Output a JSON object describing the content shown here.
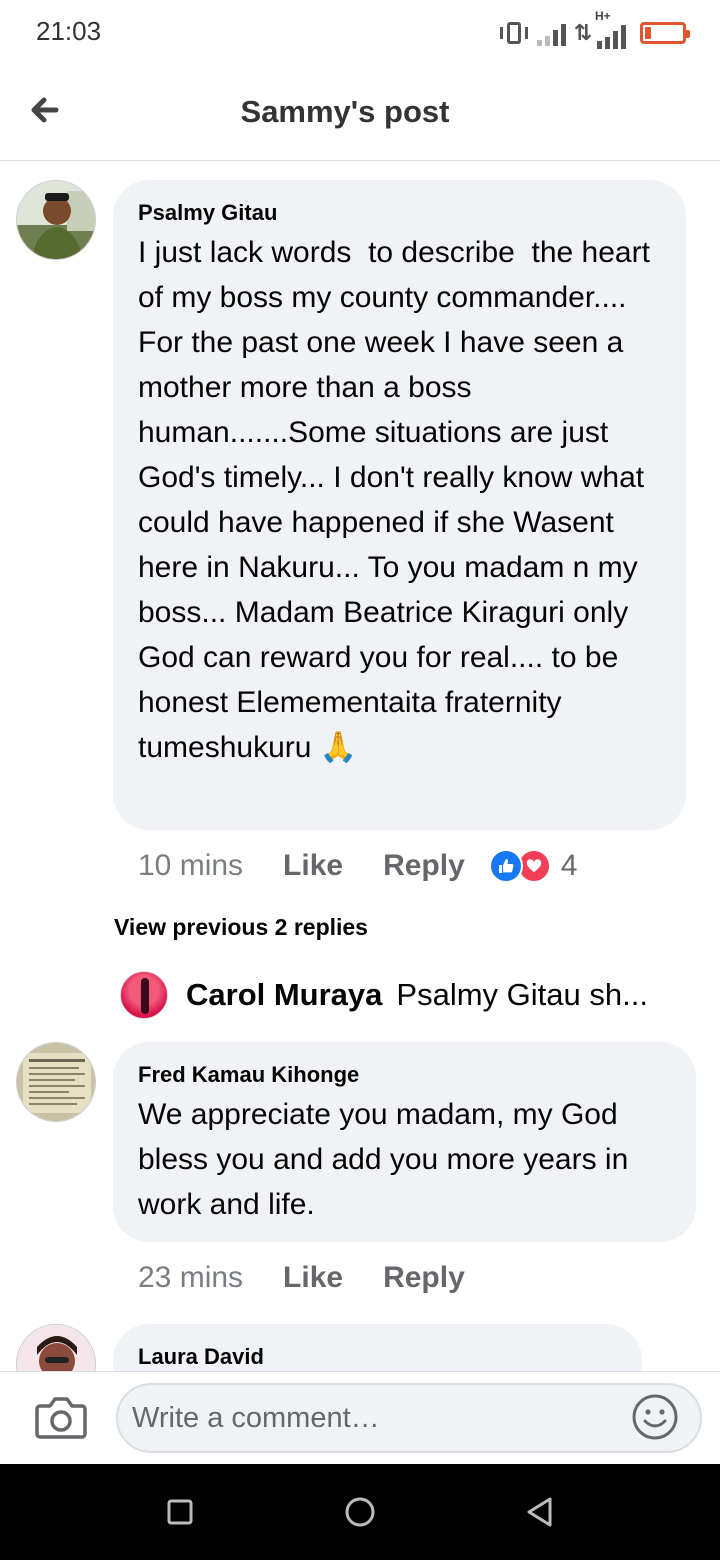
{
  "status_bar": {
    "time": "21:03",
    "network_label": "H+",
    "battery_color": "#e0552f",
    "battery_level": 0.15
  },
  "header": {
    "title": "Sammy's post",
    "back_icon": "arrow-left-icon"
  },
  "comments": [
    {
      "author": "Psalmy Gitau",
      "text": "I just lack words  to describe  the heart of my boss my county commander.... For the past one week I have seen a mother more than a boss human.......Some situations are just God's timely... I don't really know what could have happened if she Wasent here in Nakuru... To you madam n my boss... Madam Beatrice Kiraguri only God can reward you for real.... to be honest Elemementaita fraternity  tumeshukuru",
      "emoji": "🙏",
      "time": "10 mins",
      "like_label": "Like",
      "reply_label": "Reply",
      "reaction_count": "4",
      "reactions": [
        "like-icon",
        "love-icon"
      ]
    },
    {
      "author": "Fred Kamau Kihonge",
      "text": "We appreciate you madam, my God bless you and add you more years in work and life.",
      "time": "23 mins",
      "like_label": "Like",
      "reply_label": "Reply"
    },
    {
      "author": "Laura David"
    }
  ],
  "replies": {
    "view_previous": "View previous 2 replies",
    "latest": {
      "author": "Carol Muraya",
      "snippet": "Psalmy Gitau sh..."
    }
  },
  "composer": {
    "placeholder": "Write a comment…",
    "camera_icon": "camera-icon",
    "emoji_icon": "smiley-icon"
  },
  "colors": {
    "bubble": "#f0f2f5",
    "like_blue": "#1877f2",
    "love_red": "#f33e58",
    "meta_gray": "#65676b"
  }
}
